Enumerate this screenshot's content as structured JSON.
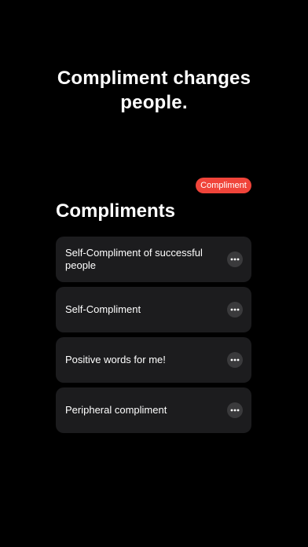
{
  "hero": {
    "line1": "Compliment changes",
    "line2": "people."
  },
  "badge": {
    "label": "Compliment",
    "color": "#f0443a"
  },
  "section": {
    "title": "Compliments"
  },
  "items": [
    {
      "label": "Self-Compliment of successful people",
      "icon": "more-horizontal-icon"
    },
    {
      "label": "Self-Compliment",
      "icon": "more-horizontal-icon"
    },
    {
      "label": "Positive words for me!",
      "icon": "more-horizontal-icon"
    },
    {
      "label": "Peripheral compliment",
      "icon": "more-horizontal-icon"
    }
  ],
  "colors": {
    "background": "#000000",
    "card": "#1c1c1e",
    "icon_button": "#3a3a3c"
  }
}
